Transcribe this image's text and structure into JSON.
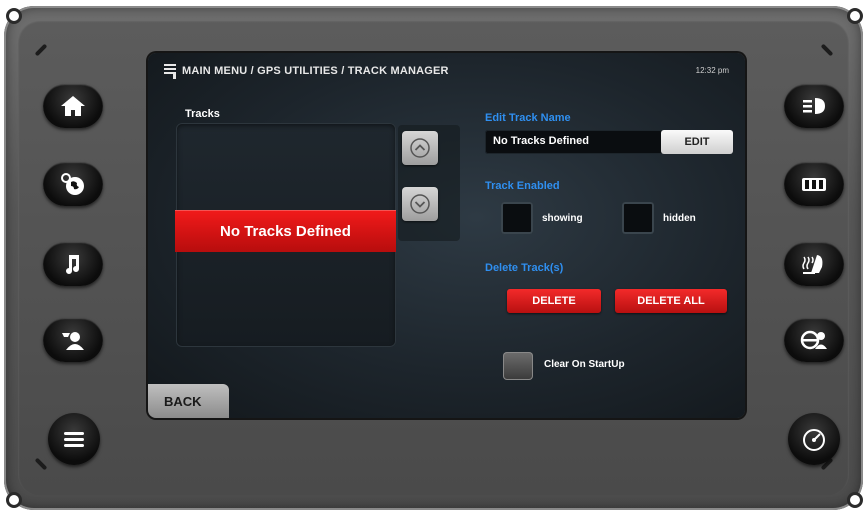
{
  "header": {
    "title": "MAIN MENU / GPS UTILITIES / TRACK MANAGER",
    "clock": "12:32 pm"
  },
  "tracks": {
    "label": "Tracks",
    "selected_item": "No Tracks Defined"
  },
  "edit": {
    "label": "Edit Track Name",
    "value": "No Tracks Defined",
    "button": "EDIT"
  },
  "enabled": {
    "label": "Track Enabled",
    "showing": "showing",
    "hidden": "hidden"
  },
  "delete": {
    "label": "Delete Track(s)",
    "delete_button": "DELETE",
    "delete_all_button": "DELETE ALL"
  },
  "clear_on_startup": {
    "label": "Clear On StartUp"
  },
  "back_button": "BACK",
  "left_buttons": [
    "home-icon",
    "globe-icon",
    "music-icon",
    "contacts-icon",
    "menu-icon"
  ],
  "right_buttons": [
    "headlight-icon",
    "battery-icon",
    "seat-heat-icon",
    "steering-icon",
    "gauge-icon"
  ],
  "colors": {
    "accent_blue": "#2f8ff0",
    "red": "#e01515"
  }
}
